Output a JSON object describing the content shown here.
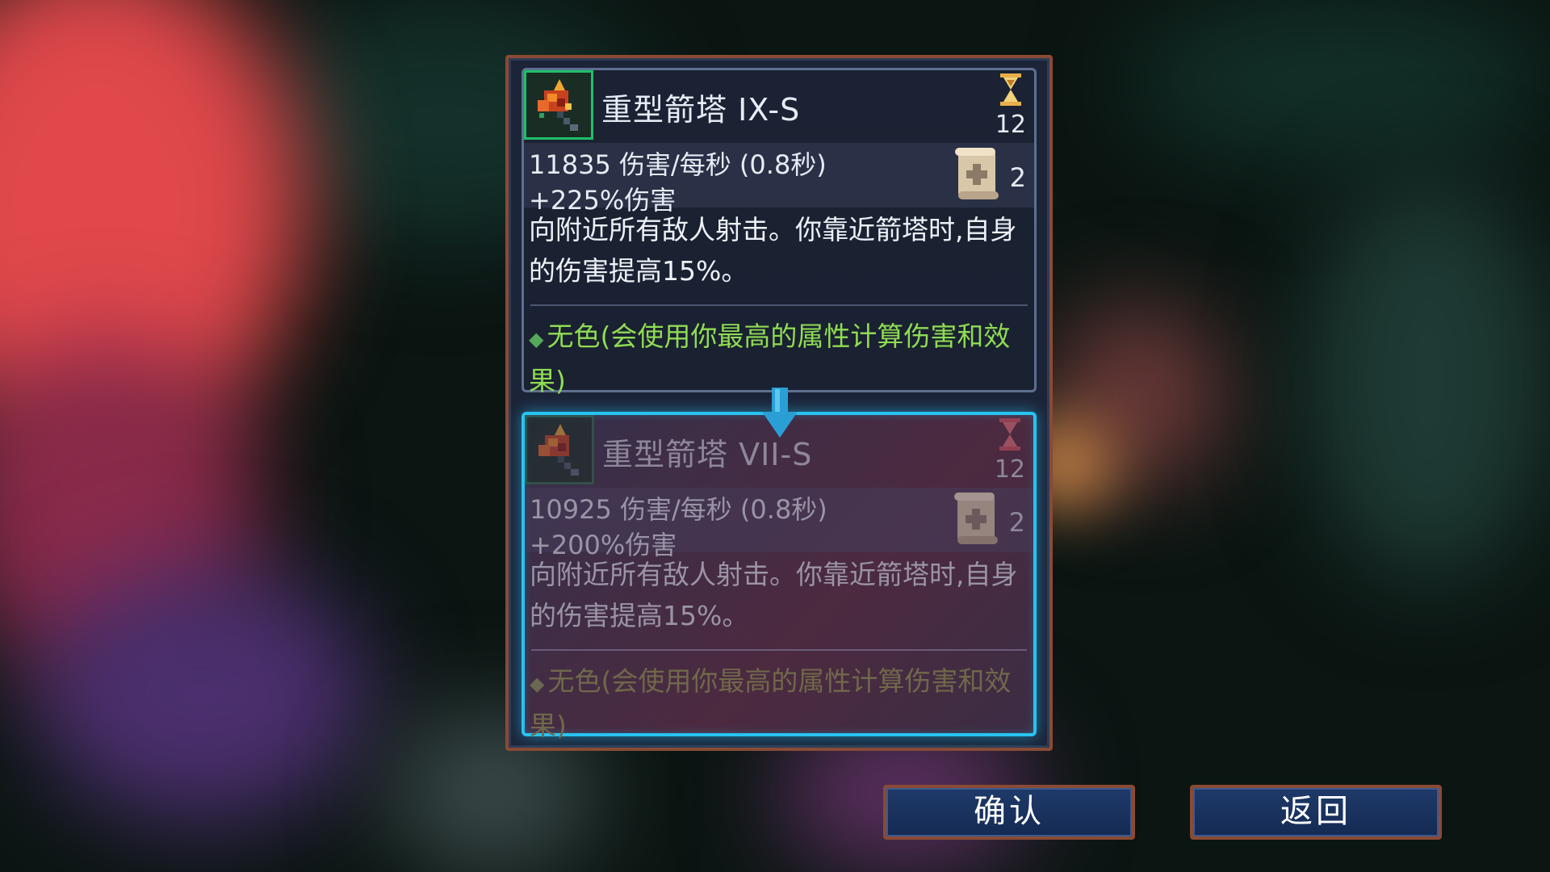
{
  "current_item": {
    "name": "重型箭塔 IX-S",
    "cooldown": "12",
    "dps": "11835 伤害/每秒 (0.8秒)",
    "bonus": "+225%伤害",
    "scroll_count": "2",
    "description": "向附近所有敌人射击。你靠近箭塔时,自身的伤害提高15%。",
    "affinity_marker": "◆",
    "affinity": "无色(会使用你最高的属性计算伤害和效果)"
  },
  "previous_item": {
    "name": "重型箭塔 VII-S",
    "cooldown": "12",
    "dps": "10925 伤害/每秒 (0.8秒)",
    "bonus": "+200%伤害",
    "scroll_count": "2",
    "description": "向附近所有敌人射击。你靠近箭塔时,自身的伤害提高15%。",
    "affinity_marker": "◆",
    "affinity": "无色(会使用你最高的属性计算伤害和效果)"
  },
  "buttons": {
    "confirm": "确认",
    "back": "返回"
  },
  "colors": {
    "selection_border": "#27c3f2",
    "affinity_green": "#8fdc52",
    "frame_border": "#8a4a33",
    "button_fill": "#1f3a6a"
  },
  "icons": {
    "tower": "heavy-turret-icon",
    "cooldown": "hourglass-icon",
    "scroll": "upgrade-scroll-icon",
    "compare": "arrow-down-icon"
  }
}
